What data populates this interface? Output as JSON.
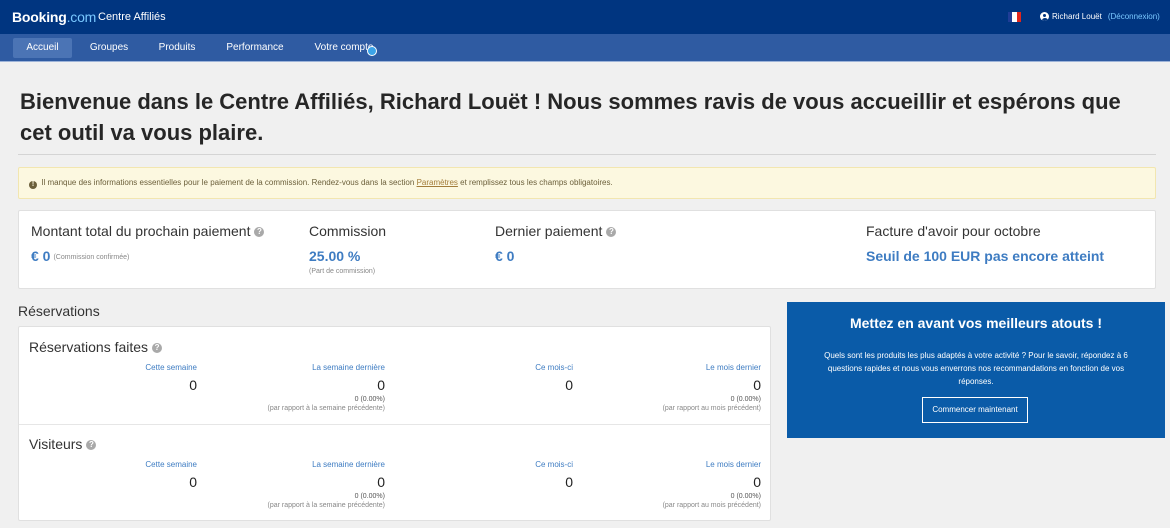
{
  "header": {
    "logo_main": "Booking",
    "logo_suffix": ".com",
    "app_title": "Centre Affiliés",
    "user_name": "Richard Louët",
    "logout_label": "(Déconnexion)",
    "language_flag": "fr-flag-icon",
    "user_icon": "user-circle-icon"
  },
  "nav": {
    "items": [
      "Accueil",
      "Groupes",
      "Produits",
      "Performance",
      "Votre compte"
    ],
    "active": "Accueil"
  },
  "welcome": {
    "title": "Bienvenue dans le Centre Affiliés, Richard Louët ! Nous sommes ravis de vous accueillir et espérons que cet outil va vous plaire."
  },
  "alert": {
    "icon": "exclamation-icon",
    "text_before": "Il manque des informations essentielles pour le paiement de la commission. Rendez-vous dans la section",
    "link_label": "Paramètres",
    "text_after": "et remplissez tous les champs obligatoires."
  },
  "summary": {
    "next_payment_label": "Montant total du prochain paiement",
    "next_payment_value": "€ 0",
    "next_payment_note": "(Commission confirmée)",
    "commission_label": "Commission",
    "commission_value": "25.00 %",
    "commission_sub": "(Part de commission)",
    "last_payment_label": "Dernier paiement",
    "last_payment_value": "€ 0",
    "invoice_label": "Facture d'avoir pour octobre",
    "invoice_value": "Seuil de 100 EUR pas encore atteint"
  },
  "reservations_section": {
    "title": "Réservations",
    "columns": [
      "Cette semaine",
      "La semaine dernière",
      "Ce mois-ci",
      "Le mois dernier"
    ],
    "bookings": {
      "title": "Réservations faites",
      "values": [
        "0",
        "0",
        "0",
        "0"
      ],
      "last_week_delta": "0 (0.00%)",
      "last_week_cmp": "(par rapport à la semaine précédente)",
      "last_month_delta": "0 (0.00%)",
      "last_month_cmp": "(par rapport au mois précédent)"
    },
    "visitors": {
      "title": "Visiteurs",
      "values": [
        "0",
        "0",
        "0",
        "0"
      ],
      "last_week_delta": "0 (0.00%)",
      "last_week_cmp": "(par rapport à la semaine précédente)",
      "last_month_delta": "0 (0.00%)",
      "last_month_cmp": "(par rapport au mois précédent)"
    }
  },
  "promo": {
    "title": "Mettez en avant vos meilleurs atouts !",
    "text": "Quels sont les produits les plus adaptés à votre activité ? Pour le savoir, répondez à 6 questions rapides et nous vous enverrons nos recommandations en fonction de vos réponses.",
    "button_label": "Commencer maintenant"
  },
  "colors": {
    "header_bg": "#003580",
    "nav_bg": "#2f5ba2",
    "accent": "#3e7cc2",
    "promo_bg": "#0a5ba8"
  }
}
